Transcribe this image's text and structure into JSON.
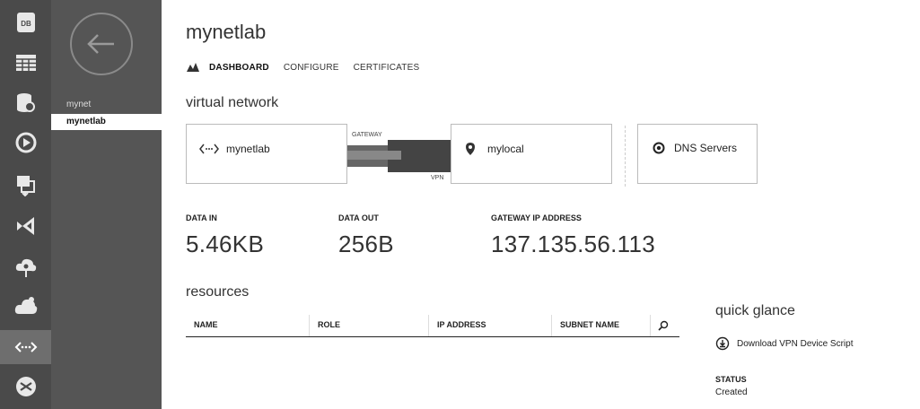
{
  "rail": {
    "items": [
      {
        "icon": "sql-database-icon",
        "text": "DB"
      },
      {
        "icon": "storage-grid-icon"
      },
      {
        "icon": "database-settings-icon"
      },
      {
        "icon": "media-services-icon"
      },
      {
        "icon": "service-bus-icon"
      },
      {
        "icon": "visual-studio-icon"
      },
      {
        "icon": "cloud-network-icon"
      },
      {
        "icon": "cloud-services-icon"
      },
      {
        "icon": "virtual-network-icon"
      },
      {
        "icon": "traffic-manager-icon"
      }
    ]
  },
  "sidebar": {
    "items": [
      {
        "label": "mynet"
      },
      {
        "label": "mynetlab"
      }
    ]
  },
  "page": {
    "title": "mynetlab",
    "tabs": [
      "DASHBOARD",
      "CONFIGURE",
      "CERTIFICATES"
    ]
  },
  "virtual_network": {
    "heading": "virtual network",
    "network_box": "mynetlab",
    "gateway_label": "GATEWAY",
    "vpn_label": "VPN",
    "local_box": "mylocal",
    "dns_box": "DNS Servers"
  },
  "stats": {
    "data_in_label": "DATA IN",
    "data_in_value": "5.46KB",
    "data_out_label": "DATA OUT",
    "data_out_value": "256B",
    "gateway_ip_label": "GATEWAY IP ADDRESS",
    "gateway_ip_value": "137.135.56.113"
  },
  "resources": {
    "heading": "resources",
    "columns": [
      "NAME",
      "ROLE",
      "IP ADDRESS",
      "SUBNET NAME"
    ]
  },
  "quick_glance": {
    "heading": "quick glance",
    "download_link": "Download VPN Device Script",
    "status_label": "STATUS",
    "status_value": "Created"
  },
  "colors": {
    "rail_bg": "#4a4a4a",
    "sidebar_bg": "#555555",
    "gateway_bar": "#555555"
  }
}
